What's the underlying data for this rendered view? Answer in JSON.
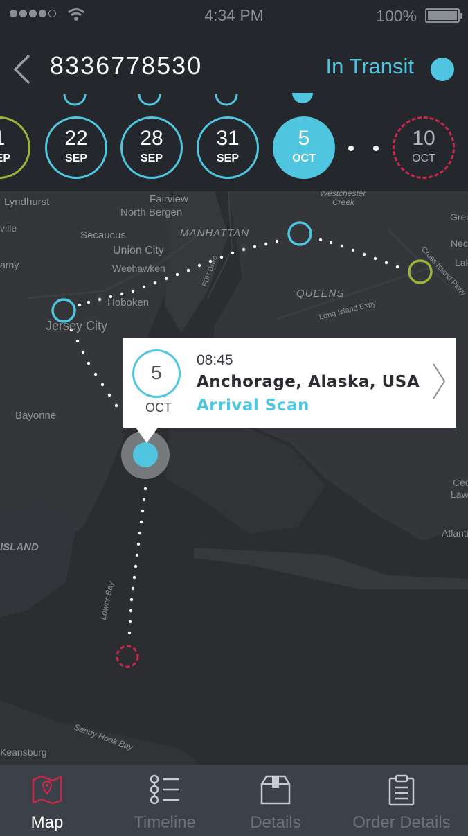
{
  "status_bar": {
    "time": "4:34 PM",
    "battery": "100%",
    "signal_icon": "signal-dots-icon",
    "wifi_icon": "wifi-icon",
    "battery_icon": "battery-icon"
  },
  "header": {
    "back_icon": "chevron-left-icon",
    "tracking_number": "8336778530",
    "status": "In Transit",
    "status_color": "#4fc5e0"
  },
  "dates": [
    {
      "day": "1",
      "month": "SEP",
      "state": "done-green"
    },
    {
      "day": "22",
      "month": "SEP",
      "state": "done"
    },
    {
      "day": "28",
      "month": "SEP",
      "state": "done"
    },
    {
      "day": "31",
      "month": "SEP",
      "state": "done"
    },
    {
      "day": "5",
      "month": "OCT",
      "state": "active"
    },
    {
      "day": "10",
      "month": "OCT",
      "state": "expected"
    }
  ],
  "map_labels": [
    {
      "text": "Lyndhurst"
    },
    {
      "text": "Fairview"
    },
    {
      "text": "North Bergen"
    },
    {
      "text": "Westchester"
    },
    {
      "text": "Creek"
    },
    {
      "text": "Secaucus"
    },
    {
      "text": "MANHATTAN"
    },
    {
      "text": "Union City"
    },
    {
      "text": "Weehawken"
    },
    {
      "text": "Hoboken"
    },
    {
      "text": "QUEENS"
    },
    {
      "text": "Jersey City"
    },
    {
      "text": "Bayonne"
    },
    {
      "text": "ISLAND"
    },
    {
      "text": "Lower Bay"
    },
    {
      "text": "Sandy Hook Bay"
    },
    {
      "text": "Keansburg"
    },
    {
      "text": "Grea"
    },
    {
      "text": "Neck"
    },
    {
      "text": "Lak"
    },
    {
      "text": "Ced"
    },
    {
      "text": "Law"
    },
    {
      "text": "Atlanti"
    },
    {
      "text": "ville"
    },
    {
      "text": "arny"
    },
    {
      "text": "Long Island Expy"
    },
    {
      "text": "Cross Island Pkwy"
    },
    {
      "text": "FDR Drive"
    }
  ],
  "popup": {
    "day": "5",
    "month": "OCT",
    "time": "08:45",
    "location": "Anchorage, Alaska, USA",
    "event": "Arrival Scan",
    "chevron_icon": "chevron-right-icon"
  },
  "tabs": [
    {
      "label": "Map",
      "icon": "map-icon",
      "active": true
    },
    {
      "label": "Timeline",
      "icon": "timeline-icon",
      "active": false
    },
    {
      "label": "Details",
      "icon": "box-icon",
      "active": false
    },
    {
      "label": "Order Details",
      "icon": "clipboard-icon",
      "active": false
    }
  ],
  "colors": {
    "accent": "#4fc5e0",
    "green": "#9bb53a",
    "alert": "#c8284a",
    "map_bg": "#2b2d30",
    "header_bg": "#24272c",
    "tabbar_bg": "#3c4048"
  }
}
